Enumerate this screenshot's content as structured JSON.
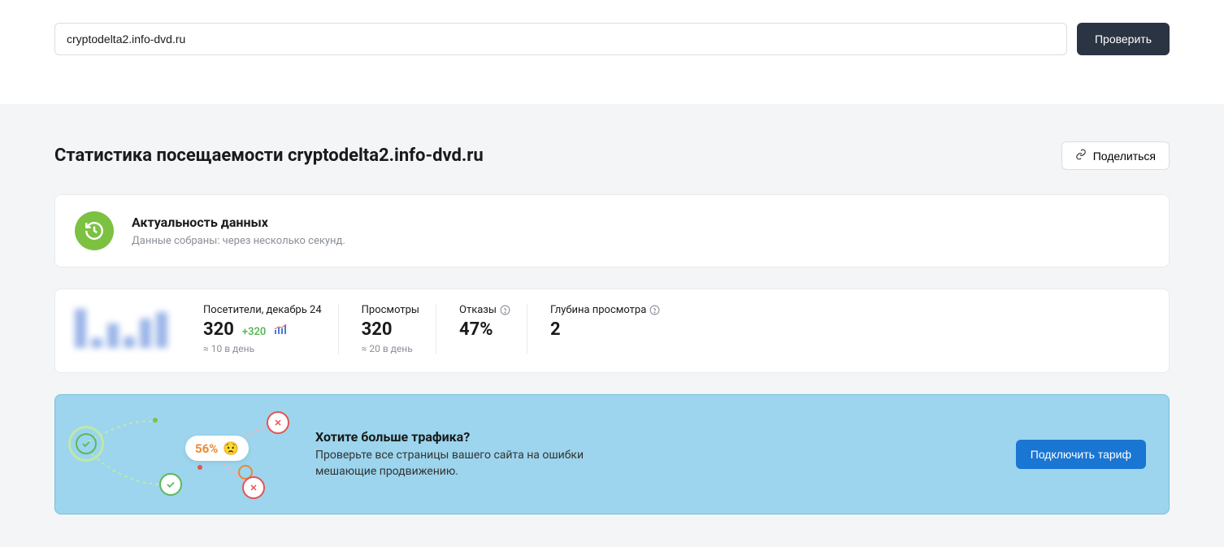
{
  "search": {
    "value": "cryptodelta2.info-dvd.ru",
    "check_label": "Проверить"
  },
  "heading": {
    "title": "Статистика посещаемости cryptodelta2.info-dvd.ru",
    "share_label": "Поделиться"
  },
  "freshness": {
    "title": "Актуальность данных",
    "subtitle": "Данные собраны: через несколько секунд."
  },
  "stats": {
    "visitors": {
      "label": "Посетители, декабрь 24",
      "value": "320",
      "delta": "+320",
      "foot": "≈ 10 в день"
    },
    "views": {
      "label": "Просмотры",
      "value": "320",
      "foot": "≈ 20 в день"
    },
    "bounces": {
      "label": "Отказы",
      "value": "47%"
    },
    "depth": {
      "label": "Глубина просмотра",
      "value": "2"
    }
  },
  "promo": {
    "pill_pct": "56%",
    "title": "Хотите больше трафика?",
    "desc1": "Проверьте все страницы вашего сайта на ошибки",
    "desc2": "мешающие продвижению.",
    "cta": "Подключить тариф"
  }
}
